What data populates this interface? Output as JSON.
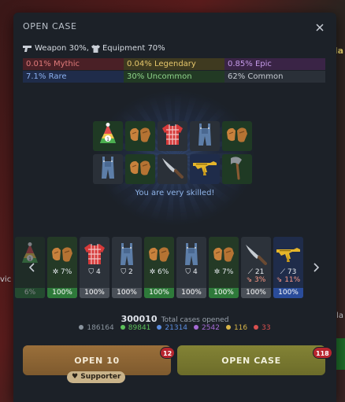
{
  "modal": {
    "title": "OPEN CASE",
    "close_icon": "close-icon"
  },
  "ratio": {
    "weapon": "Weapon 30%,",
    "equipment": "Equipment 70%"
  },
  "odds": [
    {
      "label": "0.01% Mythic",
      "color": "#e07a7a",
      "bg": "#4a2026"
    },
    {
      "label": "0.04% Legendary",
      "color": "#e6c76b",
      "bg": "#3f3a20"
    },
    {
      "label": "0.85% Epic",
      "color": "#c49ae8",
      "bg": "#3a2446"
    },
    {
      "label": "7.1% Rare",
      "color": "#8bb0f0",
      "bg": "#1f2c4a"
    },
    {
      "label": "30% Uncommon",
      "color": "#8fd48a",
      "bg": "#223a24"
    },
    {
      "label": "62% Common",
      "color": "#c6cbd2",
      "bg": "#2a3038"
    }
  ],
  "pool_items": [
    {
      "name": "party-hat-icon",
      "bg": "#1f3a24"
    },
    {
      "name": "gloves-icon",
      "bg": "#1f3a24"
    },
    {
      "name": "plaid-shirt-icon",
      "bg": "#2a3038"
    },
    {
      "name": "overalls-icon",
      "bg": "#2a3038"
    },
    {
      "name": "gloves-icon",
      "bg": "#1f3a24"
    },
    {
      "name": "overalls-icon",
      "bg": "#2a3038"
    },
    {
      "name": "gloves-icon",
      "bg": "#1f3a24"
    },
    {
      "name": "knife-icon",
      "bg": "#2a3038"
    },
    {
      "name": "golden-rifle-icon",
      "bg": "#1f2c4a"
    },
    {
      "name": "axe-icon",
      "bg": "#1f3a24"
    }
  ],
  "congrats_text": "You are very skilled!",
  "reel": {
    "items": [
      {
        "icon": "party-hat-icon",
        "stat1": "",
        "stat2": "",
        "bar": "6%",
        "bg": "#243a26",
        "bar_bg": "#2e7a3a"
      },
      {
        "icon": "gloves-icon",
        "stat1": "7%",
        "stat2": "",
        "bar": "100%",
        "bg": "#243a26",
        "bar_bg": "#2e7a3a"
      },
      {
        "icon": "plaid-shirt-icon",
        "stat1": "4",
        "stat2": "",
        "bar": "100%",
        "bg": "#2c323a",
        "bar_bg": "#4a5058"
      },
      {
        "icon": "overalls-icon",
        "stat1": "2",
        "stat2": "",
        "bar": "100%",
        "bg": "#2c323a",
        "bar_bg": "#4a5058"
      },
      {
        "icon": "gloves-icon",
        "stat1": "6%",
        "stat2": "",
        "bar": "100%",
        "bg": "#243a26",
        "bar_bg": "#2e7a3a"
      },
      {
        "icon": "overalls-icon",
        "stat1": "4",
        "stat2": "",
        "bar": "100%",
        "bg": "#2c323a",
        "bar_bg": "#4a5058"
      },
      {
        "icon": "gloves-icon",
        "stat1": "7%",
        "stat2": "",
        "bar": "100%",
        "bg": "#243a26",
        "bar_bg": "#2e7a3a"
      },
      {
        "icon": "knife-icon",
        "stat1": "21",
        "stat2": "3%",
        "bar": "100%",
        "bg": "#2c323a",
        "bar_bg": "#4a5058"
      },
      {
        "icon": "golden-rifle-icon",
        "stat1": "73",
        "stat2": "11%",
        "bar": "100%",
        "bg": "#1f2c4a",
        "bar_bg": "#2a4c9a"
      }
    ]
  },
  "totals": {
    "number": "300010",
    "label": "Total cases opened"
  },
  "rarity_counts": [
    {
      "value": "186164",
      "color": "#8a949e"
    },
    {
      "value": "89841",
      "color": "#5cc15a"
    },
    {
      "value": "21314",
      "color": "#5b8de0"
    },
    {
      "value": "2542",
      "color": "#a66ad6"
    },
    {
      "value": "116",
      "color": "#d8b548"
    },
    {
      "value": "33",
      "color": "#d9504f"
    }
  ],
  "buttons": {
    "open10_label": "OPEN 10",
    "open10_badge": "12",
    "open_label": "OPEN CASE",
    "open_badge": "118",
    "supporter_label": "Supporter"
  },
  "background": {
    "text_right_top": "lla",
    "text_left": "vic",
    "text_right": "lla"
  }
}
